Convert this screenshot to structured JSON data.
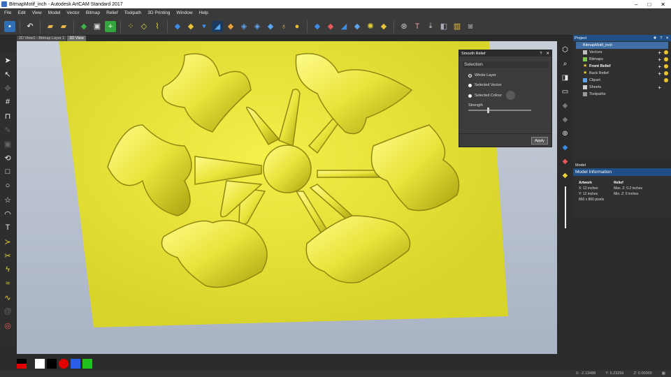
{
  "window": {
    "title": "BitmapMotif_inch - Autodesk ArtCAM Standard 2017"
  },
  "menu": [
    "File",
    "Edit",
    "View",
    "Model",
    "Vector",
    "Bitmap",
    "Relief",
    "Toolpath",
    "3D Printing",
    "Window",
    "Help"
  ],
  "tabs": [
    {
      "label": "2D View1 - Bitmap Layer 1"
    },
    {
      "label": "3D View"
    }
  ],
  "dialog": {
    "title": "Smooth Relief",
    "section": "Selection",
    "options": [
      "Whole Layer",
      "Selected Vector",
      "Selected Colour"
    ],
    "selected": "Whole Layer",
    "strength_label": "Strength",
    "strength": 0.3,
    "apply_label": "Apply"
  },
  "project": {
    "title": "Project",
    "root": "BitmapMotif_inch",
    "items": [
      {
        "label": "Vectors",
        "icon": "vectors-icon",
        "color": "#c0c0c0"
      },
      {
        "label": "Bitmaps",
        "icon": "bitmaps-icon",
        "color": "#7ec94a"
      },
      {
        "label": "Front Relief",
        "icon": "star-icon",
        "color": "#f0d030"
      },
      {
        "label": "Back Relief",
        "icon": "star-icon",
        "color": "#f0d030"
      },
      {
        "label": "Clipart",
        "icon": "clipart-icon",
        "color": "#59a6e8"
      },
      {
        "label": "Sheets",
        "icon": "sheets-icon",
        "color": "#cfcfcf"
      },
      {
        "label": "Toolpaths",
        "icon": "toolpaths-icon",
        "color": "#999999"
      }
    ]
  },
  "model": {
    "panel_title": "Model",
    "info_title": "Model Information",
    "artwork_heading": "Artwork",
    "artwork_x": "X: 12 inches",
    "artwork_y": "Y: 12 inches",
    "artwork_pixels": "860 x 860 pixels",
    "relief_heading": "Relief",
    "relief_max": "Max. Z: 0.2 inches",
    "relief_min": "Min. Z: 0 inches"
  },
  "status": {
    "x": "X: -2.13488",
    "y": "Y: 5.23256",
    "z": "Z: 0.00000"
  },
  "colors": {
    "relief": "#e6e23a",
    "panel_accent": "#1f4f85"
  },
  "palette": [
    "#e00000",
    "#ffffff",
    "#000000",
    "#e00000",
    "#2b5ee8",
    "#20c020"
  ]
}
